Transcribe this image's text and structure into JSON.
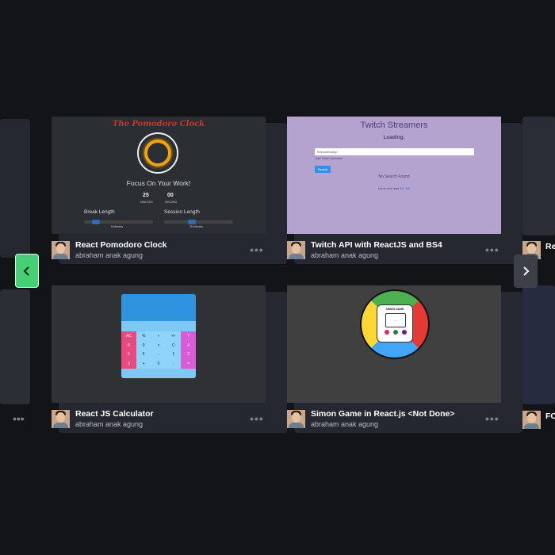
{
  "page": {
    "background": "#131417",
    "accent": "#46cf75"
  },
  "cards": [
    {
      "title": "React Pomodoro Clock",
      "author": "abraham anak agung",
      "preview": {
        "heading": "The Pomodoro Clock",
        "focus": "Focus On Your Work!",
        "minutes": "25",
        "seconds": "00",
        "minutes_label": "MINUTES",
        "seconds_label": "SECOND",
        "break_label": "Break Length",
        "session_label": "Session Length",
        "break_value": "5 Minutes",
        "session_value": "25 Minutes"
      }
    },
    {
      "title": "Twitch API with ReactJS and BS4",
      "author": "abraham anak agung",
      "preview": {
        "heading": "Twitch Streamers",
        "status": "Loading.",
        "input_value": "freecodecamp",
        "input_hint": "Type Twitch username",
        "button": "Search",
        "empty": "No Search Found",
        "footer_prefix": "Made with",
        "footer_author": "Mr. Tali"
      }
    },
    {
      "title": "React JS Calculator",
      "author": "abraham anak agung",
      "preview": {
        "keys": [
          "AC",
          "%",
          "÷",
          "+/-",
          "7",
          "8",
          "9",
          "×",
          "C",
          "4",
          "5",
          "6",
          "-",
          "1",
          "2",
          "3",
          "+",
          "0",
          ".",
          "="
        ]
      }
    },
    {
      "title": "Simon Game in React.js <Not Done>",
      "author": "abraham anak agung",
      "preview": {
        "brand": "SIMON GAME",
        "count": "--"
      }
    }
  ],
  "partial_right": {
    "title_top": "Re",
    "title_bottom": "FC"
  },
  "icons": {
    "left": "chevron-left-icon",
    "right": "chevron-right-icon",
    "more": "more-dots-icon"
  }
}
